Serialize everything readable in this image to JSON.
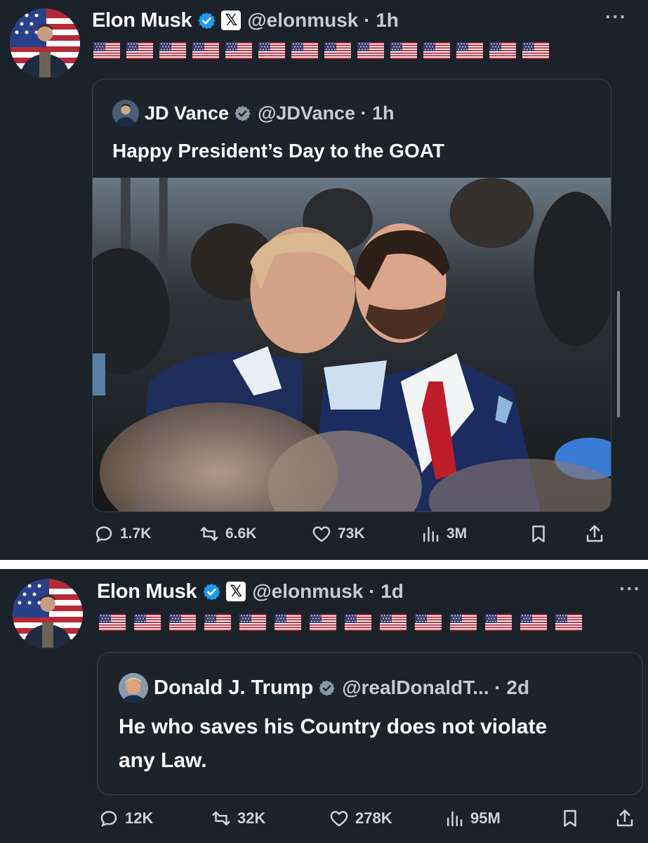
{
  "tweet1": {
    "author_name": "Elon Musk",
    "handle_time": "@elonmusk · 1h",
    "x_badge": "𝕏",
    "more": "···",
    "flag_count": 14,
    "quote": {
      "author_name": "JD Vance",
      "handle_time": "@JDVance · 1h",
      "text": "Happy President’s Day to the GOAT"
    },
    "stats": {
      "replies": "1.7K",
      "reposts": "6.6K",
      "likes": "73K",
      "views": "3M"
    }
  },
  "tweet2": {
    "author_name": "Elon Musk",
    "handle_time": "@elonmusk · 1d",
    "x_badge": "𝕏",
    "more": "···",
    "flag_count": 14,
    "quote": {
      "author_name": "Donald J. Trump",
      "handle_time": "@realDonaldT... · 2d",
      "text_line1": "He who saves his Country does not violate",
      "text_line2": "any Law."
    },
    "stats": {
      "replies": "12K",
      "reposts": "32K",
      "likes": "278K",
      "views": "95M"
    }
  },
  "colors": {
    "background": "#1c222a",
    "verified_badge": "#1d9bf0",
    "text_primary": "#ffffff",
    "text_secondary": "#c4cbd2",
    "separator": "#ffffff"
  },
  "icons": [
    "verified-icon",
    "x-logo-icon",
    "more-icon",
    "us-flag-icon",
    "reply-icon",
    "repost-icon",
    "like-icon",
    "views-icon",
    "bookmark-icon",
    "share-icon"
  ]
}
